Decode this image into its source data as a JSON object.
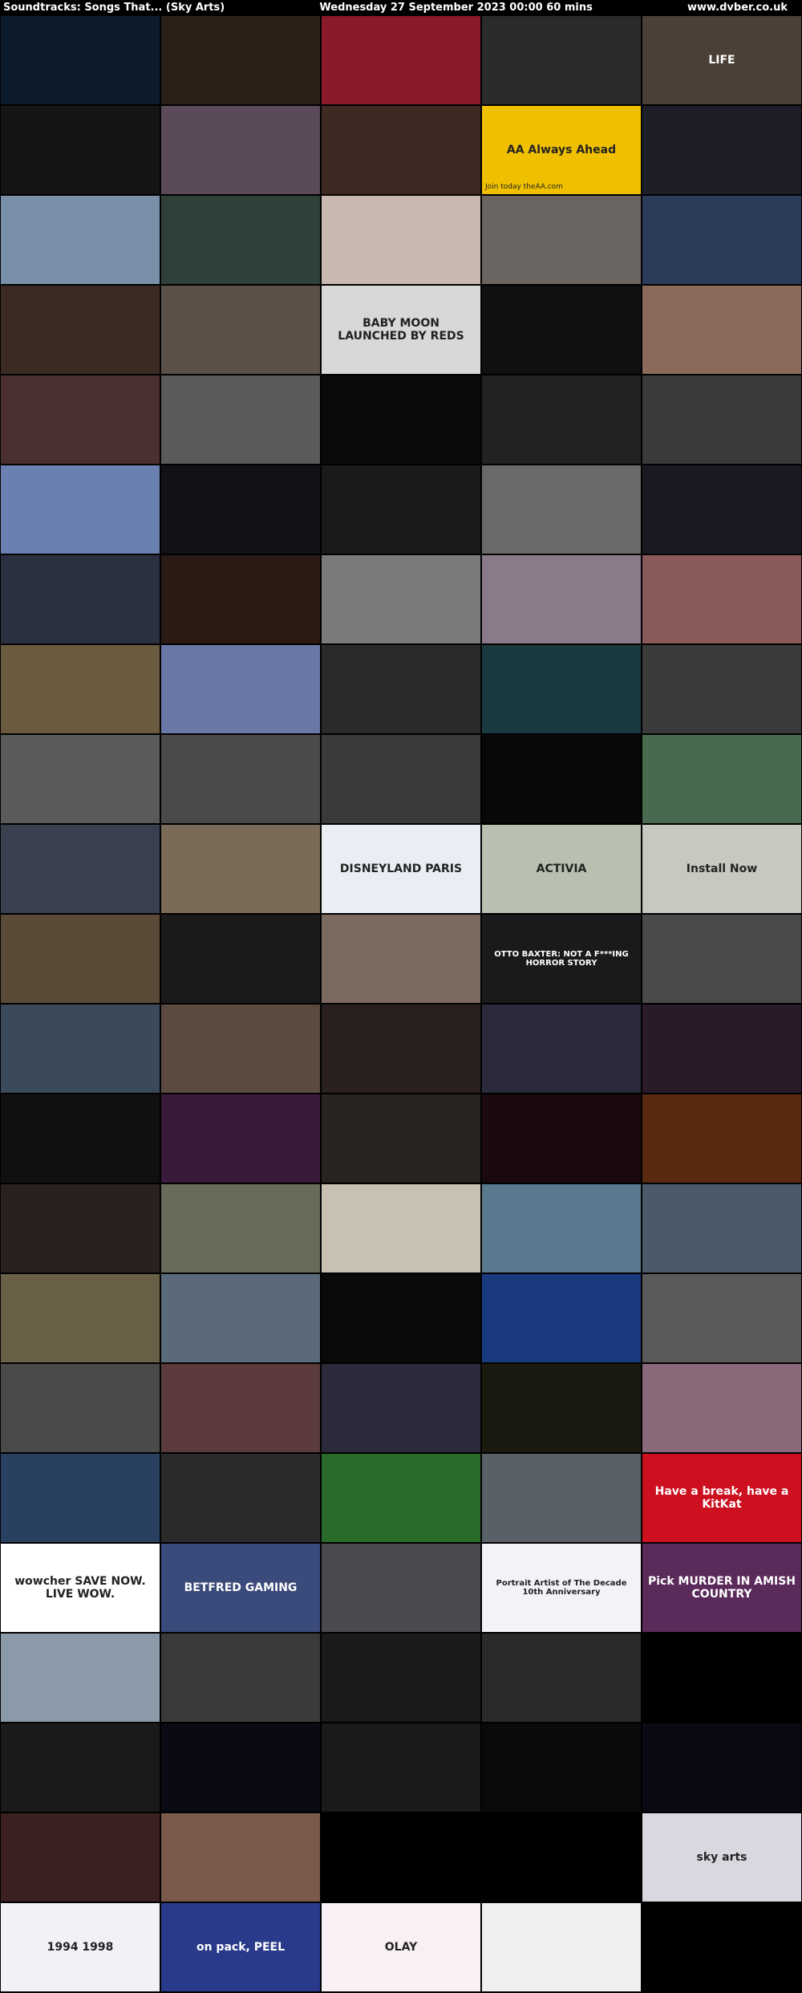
{
  "header": {
    "title": "Soundtracks: Songs That... (Sky Arts)",
    "datetime": "Wednesday 27 September 2023  00:00  60 mins",
    "site": "www.dvber.co.uk"
  },
  "frames": [
    {
      "bg": "#0c1c2c",
      "label": ""
    },
    {
      "bg": "#2a2018",
      "label": ""
    },
    {
      "bg": "#8a1a2a",
      "label": ""
    },
    {
      "bg": "#2b2b2b",
      "label": ""
    },
    {
      "bg": "#4a4036",
      "label": "LIFE"
    },
    {
      "bg": "#151515",
      "label": ""
    },
    {
      "bg": "#5b4a5a",
      "label": ""
    },
    {
      "bg": "#3d2a22",
      "label": ""
    },
    {
      "bg": "#f0c000",
      "label": "AA Always Ahead",
      "sub": "Join today theAA.com"
    },
    {
      "bg": "#1e1e28",
      "label": ""
    },
    {
      "bg": "#7a8fa8",
      "label": ""
    },
    {
      "bg": "#2e4038",
      "label": ""
    },
    {
      "bg": "#c8b8b0",
      "label": ""
    },
    {
      "bg": "#6a6560",
      "label": ""
    },
    {
      "bg": "#2c3b5a",
      "label": ""
    },
    {
      "bg": "#3a2a22",
      "label": ""
    },
    {
      "bg": "#5a5048",
      "label": ""
    },
    {
      "bg": "#d8d8d8",
      "label": "BABY MOON LAUNCHED BY REDS"
    },
    {
      "bg": "#101010",
      "label": ""
    },
    {
      "bg": "#8a6a5a",
      "label": ""
    },
    {
      "bg": "#4a3030",
      "label": ""
    },
    {
      "bg": "#5a5a5a",
      "label": ""
    },
    {
      "bg": "#0a0a0a",
      "label": ""
    },
    {
      "bg": "#222",
      "label": ""
    },
    {
      "bg": "#3a3a3a",
      "label": ""
    },
    {
      "bg": "#6a80b0",
      "label": ""
    },
    {
      "bg": "#101218",
      "label": ""
    },
    {
      "bg": "#1a1a1a",
      "label": ""
    },
    {
      "bg": "#6a6a6a",
      "label": ""
    },
    {
      "bg": "#1a1a22",
      "label": ""
    },
    {
      "bg": "#2a3040",
      "label": ""
    },
    {
      "bg": "#2a1a14",
      "label": ""
    },
    {
      "bg": "#7a7a7a",
      "label": ""
    },
    {
      "bg": "#8a7a8a",
      "label": ""
    },
    {
      "bg": "#8a5a5a",
      "label": ""
    },
    {
      "bg": "#6a5a40",
      "label": ""
    },
    {
      "bg": "#6a78a8",
      "label": ""
    },
    {
      "bg": "#2a2a2a",
      "label": ""
    },
    {
      "bg": "#1a3a40",
      "label": ""
    },
    {
      "bg": "#3a3a3a",
      "label": ""
    },
    {
      "bg": "#5a5a5a",
      "label": ""
    },
    {
      "bg": "#4a4a4a",
      "label": ""
    },
    {
      "bg": "#3a3a3a",
      "label": ""
    },
    {
      "bg": "#080808",
      "label": ""
    },
    {
      "bg": "#4a6a50",
      "label": ""
    },
    {
      "bg": "#3a4050",
      "label": ""
    },
    {
      "bg": "#7a6a58",
      "label": ""
    },
    {
      "bg": "#e8eef4",
      "label": "DISNEYLAND PARIS"
    },
    {
      "bg": "#b8c0b0",
      "label": "ACTIVIA"
    },
    {
      "bg": "#c8c8c0",
      "label": "Install Now"
    },
    {
      "bg": "#5a4a38",
      "label": ""
    },
    {
      "bg": "#1a1a1a",
      "label": ""
    },
    {
      "bg": "#7a6a60",
      "label": ""
    },
    {
      "bg": "#1a1a1a",
      "label": "OTTO BAXTER: NOT A F***ING HORROR STORY"
    },
    {
      "bg": "#4a4a4a",
      "label": ""
    },
    {
      "bg": "#3a4a5a",
      "label": ""
    },
    {
      "bg": "#5a4a40",
      "label": ""
    },
    {
      "bg": "#2a2020",
      "label": ""
    },
    {
      "bg": "#2a2a3a",
      "label": ""
    },
    {
      "bg": "#2a1a2a",
      "label": ""
    },
    {
      "bg": "#101010",
      "label": ""
    },
    {
      "bg": "#3a1a3a",
      "label": ""
    },
    {
      "bg": "#2a2420",
      "label": ""
    },
    {
      "bg": "#1a0a10",
      "label": ""
    },
    {
      "bg": "#5a2a10",
      "label": ""
    },
    {
      "bg": "#2a2020",
      "label": ""
    },
    {
      "bg": "#6a6a5a",
      "label": ""
    },
    {
      "bg": "#c8c0b0",
      "label": ""
    },
    {
      "bg": "#5a7a90",
      "label": ""
    },
    {
      "bg": "#4a5a6a",
      "label": ""
    },
    {
      "bg": "#6a6048",
      "label": ""
    },
    {
      "bg": "#5a6a7a",
      "label": ""
    },
    {
      "bg": "#0a0a0a",
      "label": ""
    },
    {
      "bg": "#1a3a80",
      "label": ""
    },
    {
      "bg": "#5a5a5a",
      "label": ""
    },
    {
      "bg": "#4a4a4a",
      "label": ""
    },
    {
      "bg": "#5a3a3a",
      "label": ""
    },
    {
      "bg": "#2a2a3a",
      "label": ""
    },
    {
      "bg": "#1a1a10",
      "label": ""
    },
    {
      "bg": "#8a6a7a",
      "label": ""
    },
    {
      "bg": "#2a4060",
      "label": ""
    },
    {
      "bg": "#2a2a2a",
      "label": ""
    },
    {
      "bg": "#2a6a2a",
      "label": ""
    },
    {
      "bg": "#5a6068",
      "label": ""
    },
    {
      "bg": "#cc1020",
      "label": "Have a break, have a KitKat"
    },
    {
      "bg": "#ffffff",
      "label": "wowcher SAVE NOW. LIVE WOW."
    },
    {
      "bg": "#3a4a7a",
      "label": "BETFRED GAMING"
    },
    {
      "bg": "#4a4a50",
      "label": ""
    },
    {
      "bg": "#f4f2f8",
      "label": "Portrait Artist of The Decade 10th Anniversary"
    },
    {
      "bg": "#5a2a5a",
      "label": "Pick MURDER IN AMISH COUNTRY"
    },
    {
      "bg": "#8a9aa8",
      "label": ""
    },
    {
      "bg": "#3a3a3a",
      "label": ""
    },
    {
      "bg": "#1a1a1a",
      "label": ""
    },
    {
      "bg": "#2a2a2a",
      "label": ""
    },
    {
      "bg": "#000000",
      "label": ""
    },
    {
      "bg": "#1a1a1a",
      "label": ""
    },
    {
      "bg": "#0a0a14",
      "label": ""
    },
    {
      "bg": "#1a1a1a",
      "label": ""
    },
    {
      "bg": "#0a0a0a",
      "label": ""
    },
    {
      "bg": "#0a0a14",
      "label": ""
    },
    {
      "bg": "#3a2020",
      "label": ""
    },
    {
      "bg": "#7a5a4a",
      "label": ""
    },
    {
      "bg": "#000000",
      "label": ""
    },
    {
      "bg": "#000000",
      "label": ""
    },
    {
      "bg": "#d8d8e0",
      "label": "sky arts"
    },
    {
      "bg": "#f0f2f8",
      "label": "1994 1998"
    },
    {
      "bg": "#2a3a8a",
      "label": "on pack, PEEL"
    },
    {
      "bg": "#f8f0f4",
      "label": "OLAY"
    },
    {
      "bg": "#f0f0f0",
      "label": ""
    },
    {
      "bg": "#000000",
      "label": ""
    }
  ]
}
